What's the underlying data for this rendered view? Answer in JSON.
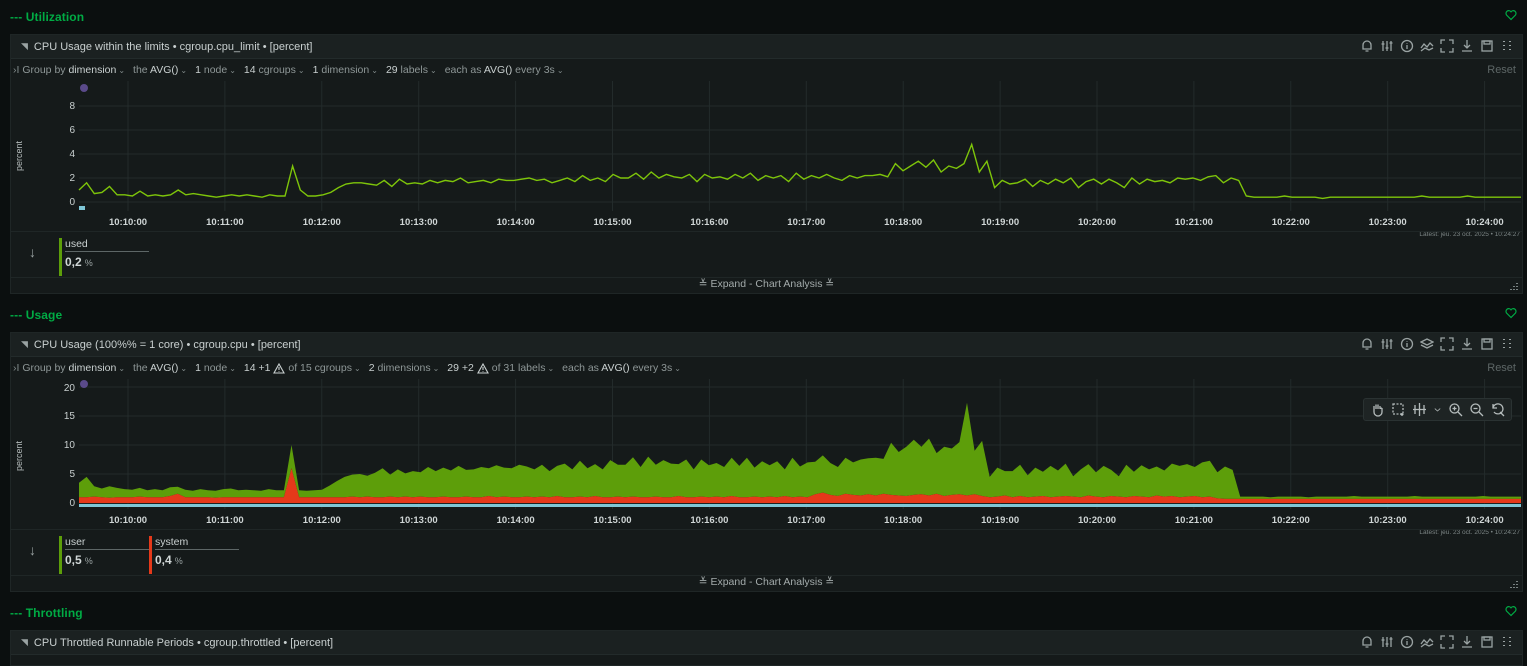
{
  "sections": [
    {
      "title": "--- Utilization"
    },
    {
      "title": "--- Usage"
    },
    {
      "title": "--- Throttling"
    }
  ],
  "cards": [
    {
      "title": "CPU Usage within the limits • cgroup.cpu_limit • [percent]",
      "group_by_label": "Group by",
      "group_by_value": "dimension",
      "aggregate_label": "the",
      "aggregate_value": "AVG()",
      "nodes_count": "1",
      "nodes_label": "node",
      "cgroups_count": "14",
      "cgroups_label": "cgroups",
      "dims_count": "1",
      "dims_label": "dimension",
      "labels_count": "29",
      "labels_label": "labels",
      "each_label": "each as",
      "each_value": "AVG()",
      "every_label": "every 3s",
      "reset_label": "Reset",
      "ylabel": "percent",
      "yticks": [
        "8",
        "6",
        "4",
        "2",
        "0"
      ],
      "latest": "Latest: jeu. 23 oct. 2025 • 10:24:27",
      "legend": [
        {
          "name": "used",
          "value": "0,2",
          "unit": "%",
          "color": "#5d9e0a"
        }
      ],
      "expand_label": "≚ Expand - Chart Analysis ≚"
    },
    {
      "title": "CPU Usage (100%% = 1 core) • cgroup.cpu • [percent]",
      "group_by_label": "Group by",
      "group_by_value": "dimension",
      "aggregate_label": "the",
      "aggregate_value": "AVG()",
      "nodes_count": "1",
      "nodes_label": "node",
      "cgroups_count": "14",
      "cgroups_extra": "+1",
      "cgroups_label": "of 15 cgroups",
      "dims_count": "2",
      "dims_label": "dimensions",
      "labels_count": "29",
      "labels_extra": "+2",
      "labels_label": "of 31 labels",
      "each_label": "each as",
      "each_value": "AVG()",
      "every_label": "every 3s",
      "reset_label": "Reset",
      "ylabel": "percent",
      "yticks": [
        "20",
        "15",
        "10",
        "5",
        "0"
      ],
      "latest": "Latest: jeu. 23 oct. 2025 • 10:24:27",
      "legend": [
        {
          "name": "user",
          "value": "0,5",
          "unit": "%",
          "color": "#5d9e0a"
        },
        {
          "name": "system",
          "value": "0,4",
          "unit": "%",
          "color": "#e5391a"
        }
      ],
      "expand_label": "≚ Expand - Chart Analysis ≚"
    },
    {
      "title": "CPU Throttled Runnable Periods • cgroup.throttled • [percent]"
    }
  ],
  "x_ticks": [
    "10:10:00",
    "10:11:00",
    "10:12:00",
    "10:13:00",
    "10:14:00",
    "10:15:00",
    "10:16:00",
    "10:17:00",
    "10:18:00",
    "10:19:00",
    "10:20:00",
    "10:21:00",
    "10:22:00",
    "10:23:00",
    "10:24:00"
  ],
  "chart_data": [
    {
      "type": "line",
      "title": "CPU Usage within the limits",
      "ylabel": "percent",
      "ylim": [
        0,
        9
      ],
      "x_start": "10:09:26",
      "x_end": "10:24:27",
      "series": [
        {
          "name": "used",
          "color": "#7ec50a",
          "values": [
            1.0,
            1.6,
            0.7,
            0.8,
            1.3,
            0.6,
            0.6,
            0.5,
            0.9,
            0.5,
            0.6,
            0.5,
            0.6,
            1.0,
            0.6,
            0.7,
            0.6,
            0.5,
            0.4,
            0.5,
            0.6,
            0.5,
            0.6,
            0.5,
            0.4,
            0.6,
            0.5,
            0.5,
            3.0,
            1.0,
            0.5,
            0.5,
            0.6,
            0.8,
            1.2,
            1.5,
            1.6,
            1.6,
            1.5,
            1.4,
            1.8,
            1.3,
            1.9,
            1.5,
            1.6,
            1.5,
            1.8,
            1.6,
            1.8,
            1.7,
            2.0,
            1.6,
            1.7,
            1.8,
            1.6,
            1.9,
            1.8,
            1.8,
            1.9,
            2.0,
            1.8,
            1.9,
            1.6,
            1.8,
            2.0,
            1.7,
            2.2,
            1.8,
            2.0,
            1.7,
            2.3,
            2.0,
            2.0,
            2.4,
            1.9,
            2.5,
            2.0,
            2.3,
            2.1,
            2.0,
            2.3,
            1.7,
            2.3,
            2.0,
            2.1,
            1.9,
            2.3,
            2.0,
            2.4,
            1.8,
            2.2,
            2.0,
            2.2,
            1.7,
            2.4,
            1.9,
            2.2,
            2.0,
            2.3,
            2.0,
            1.8,
            2.2,
            2.0,
            2.2,
            2.2,
            2.3,
            2.1,
            3.2,
            2.6,
            3.0,
            3.4,
            2.9,
            3.5,
            2.5,
            3.0,
            2.8,
            3.2,
            4.8,
            2.5,
            3.4,
            1.2,
            1.8,
            1.5,
            1.6,
            1.9,
            1.3,
            1.8,
            1.5,
            1.9,
            1.6,
            2.0,
            1.2,
            1.7,
            1.9,
            1.5,
            1.9,
            1.6,
            1.2,
            2.0,
            1.5,
            1.9,
            1.7,
            1.8,
            1.6,
            2.0,
            1.9,
            2.0,
            1.8,
            2.1,
            2.2,
            1.6,
            2.0,
            1.8,
            0.5,
            0.4,
            0.4,
            0.4,
            0.4,
            0.5,
            0.4,
            0.4,
            0.4,
            0.4,
            0.3,
            0.4,
            0.4,
            0.4,
            0.4,
            0.4,
            0.4,
            0.4,
            0.4,
            0.4,
            0.4,
            0.4,
            0.4,
            0.5,
            0.4,
            0.4,
            0.4,
            0.4,
            0.4,
            0.5,
            0.4,
            0.4,
            0.4,
            0.4,
            0.4,
            0.4,
            0.4
          ]
        }
      ]
    },
    {
      "type": "area",
      "title": "CPU Usage (100%% = 1 core)",
      "ylabel": "percent",
      "ylim": [
        0,
        20
      ],
      "x_start": "10:09:26",
      "x_end": "10:24:27",
      "series": [
        {
          "name": "system",
          "color": "#e5391a",
          "values": [
            1.0,
            1.0,
            1.1,
            1.0,
            0.9,
            1.0,
            1.0,
            1.0,
            1.1,
            1.0,
            1.0,
            1.0,
            1.2,
            1.6,
            1.0,
            1.0,
            1.0,
            1.0,
            0.9,
            1.0,
            1.0,
            1.0,
            1.0,
            1.0,
            1.0,
            1.0,
            1.0,
            1.0,
            6.0,
            1.0,
            1.0,
            1.0,
            1.0,
            1.0,
            1.0,
            1.0,
            1.1,
            1.0,
            1.1,
            1.0,
            1.0,
            1.1,
            1.0,
            1.1,
            1.0,
            1.1,
            1.0,
            1.0,
            1.1,
            1.0,
            1.0,
            1.1,
            1.0,
            1.0,
            1.2,
            1.0,
            1.1,
            1.0,
            1.0,
            1.1,
            1.0,
            1.1,
            1.0,
            1.2,
            1.0,
            1.0,
            1.1,
            1.0,
            1.2,
            1.0,
            1.0,
            1.1,
            1.0,
            1.1,
            1.0,
            1.0,
            1.1,
            1.0,
            1.0,
            1.2,
            1.0,
            1.0,
            1.1,
            1.0,
            1.1,
            1.0,
            1.2,
            1.0,
            1.0,
            1.1,
            1.0,
            1.1,
            1.0,
            1.2,
            1.0,
            1.1,
            1.0,
            1.5,
            1.8,
            1.4,
            1.2,
            1.6,
            1.4,
            1.3,
            1.5,
            1.3,
            1.6,
            1.4,
            1.3,
            1.2,
            1.4,
            1.5,
            1.3,
            1.6,
            1.2,
            1.4,
            1.5,
            1.3,
            1.5,
            1.2,
            1.0,
            1.1,
            1.3,
            1.0,
            1.2,
            1.0,
            1.1,
            1.2,
            1.0,
            1.1,
            1.2,
            1.1,
            1.0,
            1.3,
            1.1,
            1.0,
            1.2,
            1.1,
            1.0,
            1.2,
            1.1,
            1.0,
            1.3,
            1.1,
            1.2,
            1.0,
            1.1,
            1.2,
            1.0,
            1.1,
            0.8,
            0.7,
            0.7,
            0.7,
            0.7,
            0.7,
            0.7,
            0.7,
            0.7,
            0.7,
            0.7,
            0.7,
            0.7,
            0.7,
            0.7,
            0.7,
            0.7,
            0.7,
            0.7,
            0.7,
            0.7,
            0.7,
            0.7,
            0.7,
            0.7,
            0.7,
            0.7,
            0.7,
            0.7,
            0.7,
            0.7,
            0.7,
            0.7,
            0.7,
            0.7,
            0.7,
            0.7,
            0.7,
            0.7,
            0.7,
            0.7
          ]
        },
        {
          "name": "user",
          "color": "#5d9e0a",
          "values": [
            2.5,
            3.5,
            1.8,
            1.5,
            2.0,
            1.6,
            1.4,
            1.3,
            1.5,
            1.2,
            1.4,
            1.2,
            1.5,
            1.2,
            1.3,
            1.1,
            1.4,
            1.2,
            1.2,
            1.4,
            1.5,
            1.2,
            1.3,
            1.2,
            1.1,
            1.4,
            1.2,
            1.2,
            4.0,
            1.2,
            1.1,
            1.2,
            1.3,
            2.0,
            2.8,
            3.5,
            3.8,
            4.0,
            3.6,
            4.2,
            5.0,
            3.8,
            4.8,
            4.0,
            4.5,
            4.2,
            5.2,
            4.5,
            5.0,
            4.6,
            5.4,
            4.6,
            4.8,
            5.2,
            4.8,
            5.5,
            5.0,
            5.0,
            5.6,
            5.2,
            4.8,
            5.5,
            4.5,
            5.2,
            5.8,
            4.8,
            6.2,
            5.0,
            5.5,
            4.8,
            6.4,
            5.5,
            5.6,
            6.8,
            5.2,
            7.0,
            5.5,
            6.4,
            5.8,
            5.5,
            6.5,
            4.8,
            6.4,
            5.5,
            5.8,
            5.2,
            6.6,
            5.4,
            6.8,
            5.0,
            6.2,
            5.4,
            6.2,
            4.6,
            6.8,
            5.2,
            6.0,
            5.6,
            6.4,
            5.5,
            5.0,
            6.2,
            5.6,
            6.2,
            6.2,
            6.5,
            6.0,
            9.0,
            7.5,
            8.5,
            9.5,
            8.2,
            9.8,
            7.0,
            8.5,
            8.0,
            9.0,
            16.0,
            7.5,
            9.5,
            3.5,
            5.0,
            4.2,
            4.5,
            5.4,
            3.8,
            5.0,
            4.2,
            5.4,
            4.5,
            5.6,
            3.5,
            4.8,
            5.4,
            4.2,
            5.4,
            4.5,
            3.5,
            5.6,
            4.2,
            5.4,
            4.8,
            5.0,
            4.5,
            5.6,
            5.4,
            5.6,
            5.0,
            6.0,
            6.2,
            4.5,
            5.6,
            5.0,
            0.4,
            0.4,
            0.4,
            0.4,
            0.3,
            0.4,
            0.4,
            0.4,
            0.4,
            0.3,
            0.4,
            0.4,
            0.4,
            0.4,
            0.4,
            0.5,
            0.4,
            0.4,
            0.4,
            0.4,
            0.4,
            0.4,
            0.4,
            0.5,
            0.4,
            0.4,
            0.4,
            0.4,
            0.4,
            0.4,
            0.4,
            0.4,
            0.5,
            0.4,
            0.4,
            0.4,
            0.4,
            0.4,
            0.4,
            0.4
          ]
        }
      ]
    }
  ]
}
